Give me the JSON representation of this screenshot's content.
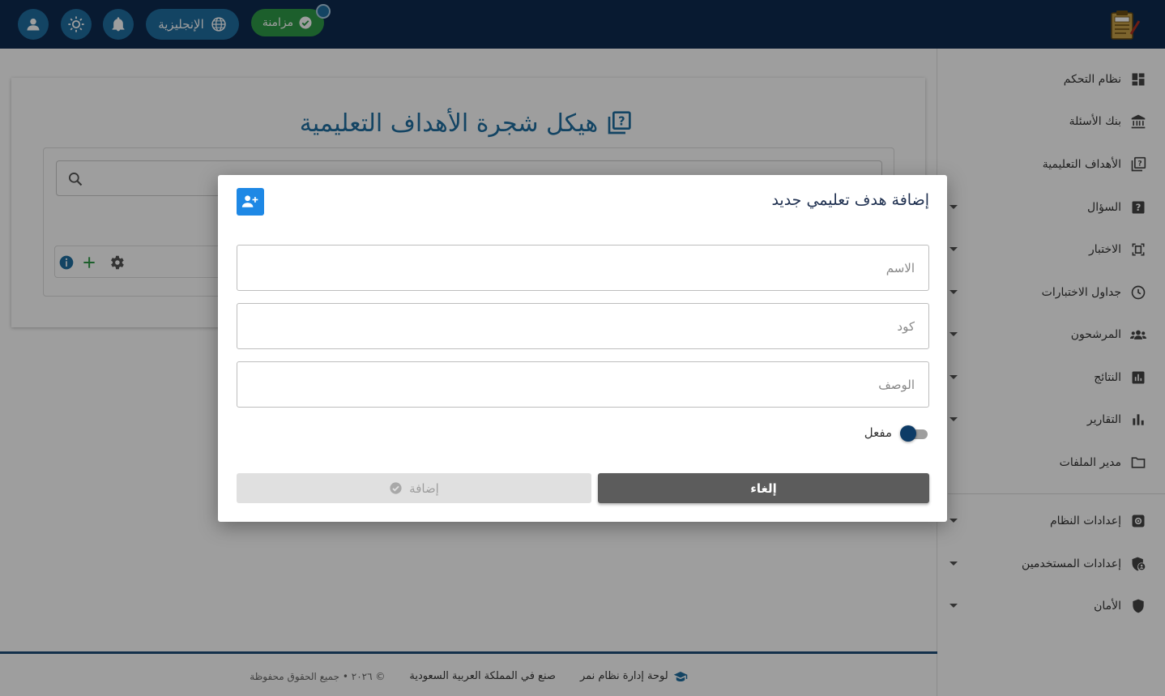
{
  "topbar": {
    "sync_label": "مزامنة",
    "language_label": "الإنجليزية",
    "icons": [
      "user-icon",
      "sun-icon",
      "bell-icon",
      "globe-icon",
      "check-circle-icon"
    ],
    "colors": {
      "bar": "#0d2b4f",
      "button": "#1f6ea1",
      "sync": "#2e9a47"
    }
  },
  "sidebar": {
    "items": [
      {
        "label": "نظام التحكم",
        "icon": "dashboard-icon",
        "expandable": false
      },
      {
        "label": "بنك الأسئلة",
        "icon": "bank-icon",
        "expandable": false
      },
      {
        "label": "الأهداف التعليمية",
        "icon": "quiz-icon",
        "expandable": false
      },
      {
        "label": "السؤال",
        "icon": "question-icon",
        "expandable": true
      },
      {
        "label": "الاختبار",
        "icon": "exam-icon",
        "expandable": true
      },
      {
        "label": "جداول الاختبارات",
        "icon": "clock-icon",
        "expandable": true
      },
      {
        "label": "المرشحون",
        "icon": "people-icon",
        "expandable": true
      },
      {
        "label": "النتائج",
        "icon": "results-icon",
        "expandable": true
      },
      {
        "label": "التقارير",
        "icon": "bar-chart-icon",
        "expandable": true
      },
      {
        "label": "مدير الملفات",
        "icon": "folder-icon",
        "expandable": false
      },
      {
        "label": "إعدادات النظام",
        "icon": "settings-icon",
        "expandable": true
      },
      {
        "label": "إعدادات المستخدمين",
        "icon": "user-shield-icon",
        "expandable": true
      },
      {
        "label": "الأمان",
        "icon": "shield-icon",
        "expandable": true
      }
    ]
  },
  "main": {
    "title": "هيكل شجرة الأهداف التعليمية"
  },
  "modal": {
    "title": "إضافة هدف تعليمي جديد",
    "fields": {
      "name_placeholder": "الاسم",
      "code_placeholder": "كود",
      "description_placeholder": "الوصف"
    },
    "toggle_label": "مفعل",
    "toggle_on": true,
    "add_label": "إضافة",
    "cancel_label": "إلغاء",
    "colors": {
      "icon_bg": "#1e88e5",
      "cancel_bg": "#5c5c5c",
      "add_bg_disabled": "#e0e0e0"
    }
  },
  "footer": {
    "brand": "لوحة إدارة نظام نمر",
    "made_in": "صنع في المملكة العربية السعودية",
    "copyright": "© ٢٠٢٦ • جميع الحقوق محفوظة"
  }
}
